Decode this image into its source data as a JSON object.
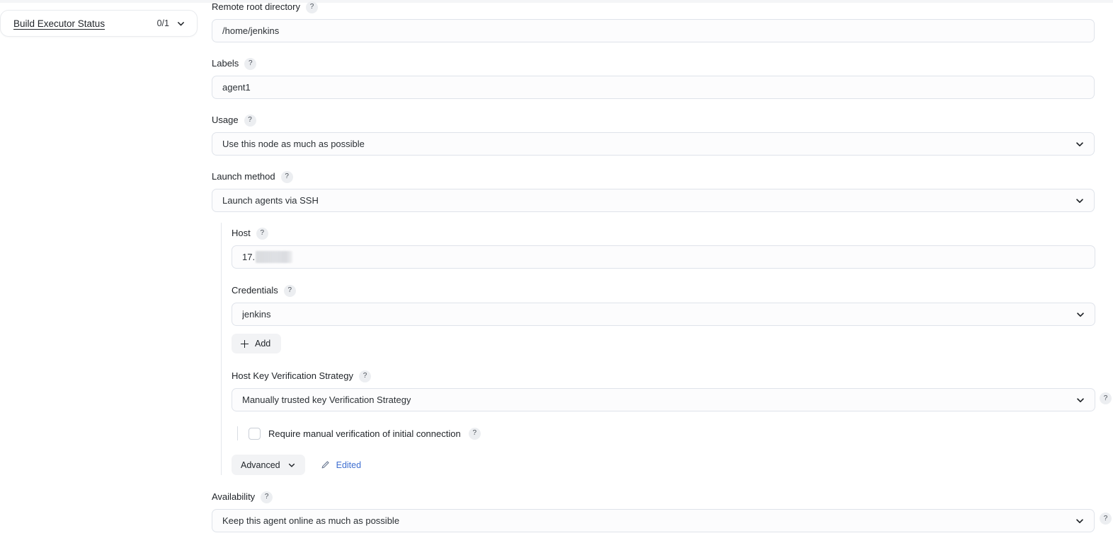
{
  "sidebar": {
    "executor_status": {
      "label": "Build Executor Status",
      "count": "0/1",
      "chevron_icon": "chevron-down-icon"
    }
  },
  "form": {
    "help_badge": "?",
    "fields": {
      "remote_root_directory": {
        "label": "Remote root directory",
        "value": "/home/jenkins"
      },
      "labels": {
        "label": "Labels",
        "value": "agent1"
      },
      "usage": {
        "label": "Usage",
        "value": "Use this node as much as possible"
      },
      "launch_method": {
        "label": "Launch method",
        "value": "Launch agents via SSH"
      },
      "host": {
        "label": "Host",
        "value": "17."
      },
      "credentials": {
        "label": "Credentials",
        "value": "jenkins"
      },
      "host_key_verification_strategy": {
        "label": "Host Key Verification Strategy",
        "value": "Manually trusted key Verification Strategy"
      },
      "availability": {
        "label": "Availability",
        "value": "Keep this agent online as much as possible"
      }
    },
    "add_button": {
      "label": "Add",
      "icon": "plus-icon"
    },
    "require_manual_verification": {
      "label": "Require manual verification of initial connection",
      "checked": false
    },
    "advanced_button": {
      "label": "Advanced",
      "chevron_icon": "chevron-down-icon"
    },
    "edited_link": {
      "label": "Edited",
      "icon": "pencil-icon"
    }
  },
  "colors": {
    "link": "#3f6fd1",
    "input_border": "#dfe3ea",
    "input_bg": "#fcfcfd",
    "button_bg": "#f2f3f5",
    "help_badge_bg": "#eceef1"
  }
}
